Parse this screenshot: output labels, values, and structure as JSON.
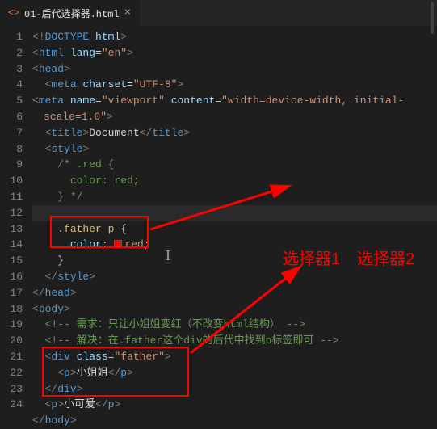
{
  "tab": {
    "icon": "<>",
    "title": "01-后代选择器.html",
    "close": "×"
  },
  "gutter": [
    "1",
    "2",
    "3",
    "4",
    "5",
    "6",
    "7",
    "8",
    "9",
    "10",
    "11",
    "12",
    "13",
    "14",
    "15",
    "16",
    "17",
    "18",
    "19",
    "20",
    "21",
    "22",
    "23",
    "24"
  ],
  "code": {
    "l1": {
      "a": "<!",
      "b": "DOCTYPE ",
      "c": "html",
      "d": ">"
    },
    "l2": {
      "a": "<",
      "b": "html ",
      "c": "lang",
      "d": "=",
      "e": "\"en\"",
      "f": ">"
    },
    "l3": {
      "a": "<",
      "b": "head",
      "c": ">"
    },
    "l4": {
      "a": "<",
      "b": "meta ",
      "c": "charset",
      "d": "=",
      "e": "\"UTF-8\"",
      "f": ">"
    },
    "l5": {
      "a": "<",
      "b": "meta ",
      "c": "name",
      "d": "=",
      "e": "\"viewport\" ",
      "f": "content",
      "g": "=",
      "h": "\"width=device-width, initial-scale=1.0\"",
      "i": ">"
    },
    "l6": {
      "a": "<",
      "b": "title",
      "c": ">",
      "d": "Document",
      "e": "</",
      "f": "title",
      "g": ">"
    },
    "l7": {
      "a": "<",
      "b": "style",
      "c": ">"
    },
    "l8": {
      "a": "/* .red {"
    },
    "l9": {
      "a": "  color: red;"
    },
    "l10": {
      "a": "} */"
    },
    "l11": {
      "a": ""
    },
    "l12": {
      "a": ".father p",
      "b": " {"
    },
    "l13": {
      "a": "color",
      "b": ": ",
      "c": "red",
      "d": ";"
    },
    "l14": {
      "a": "}"
    },
    "l15": {
      "a": "</",
      "b": "style",
      "c": ">"
    },
    "l16": {
      "a": "</",
      "b": "head",
      "c": ">"
    },
    "l17": {
      "a": "<",
      "b": "body",
      "c": ">"
    },
    "l18": {
      "a": "<!-- 需求：只让小姐姐变红（不改变html结构） -->"
    },
    "l19": {
      "a": "<!-- 解决：在.father这个div的后代中找到p标签即可 -->"
    },
    "l20": {
      "a": "<",
      "b": "div ",
      "c": "class",
      "d": "=",
      "e": "\"father\"",
      "f": ">"
    },
    "l21": {
      "a": "<",
      "b": "p",
      "c": ">",
      "d": "小姐姐",
      "e": "</",
      "f": "p",
      "g": ">"
    },
    "l22": {
      "a": "</",
      "b": "div",
      "c": ">"
    },
    "l23": {
      "a": "<",
      "b": "p",
      "c": ">",
      "d": "小可爱",
      "e": "</",
      "f": "p",
      "g": ">"
    },
    "l24": {
      "a": "</",
      "b": "body",
      "c": ">"
    }
  },
  "annotations": {
    "label1": "选择器1",
    "label2": "选择器2"
  }
}
